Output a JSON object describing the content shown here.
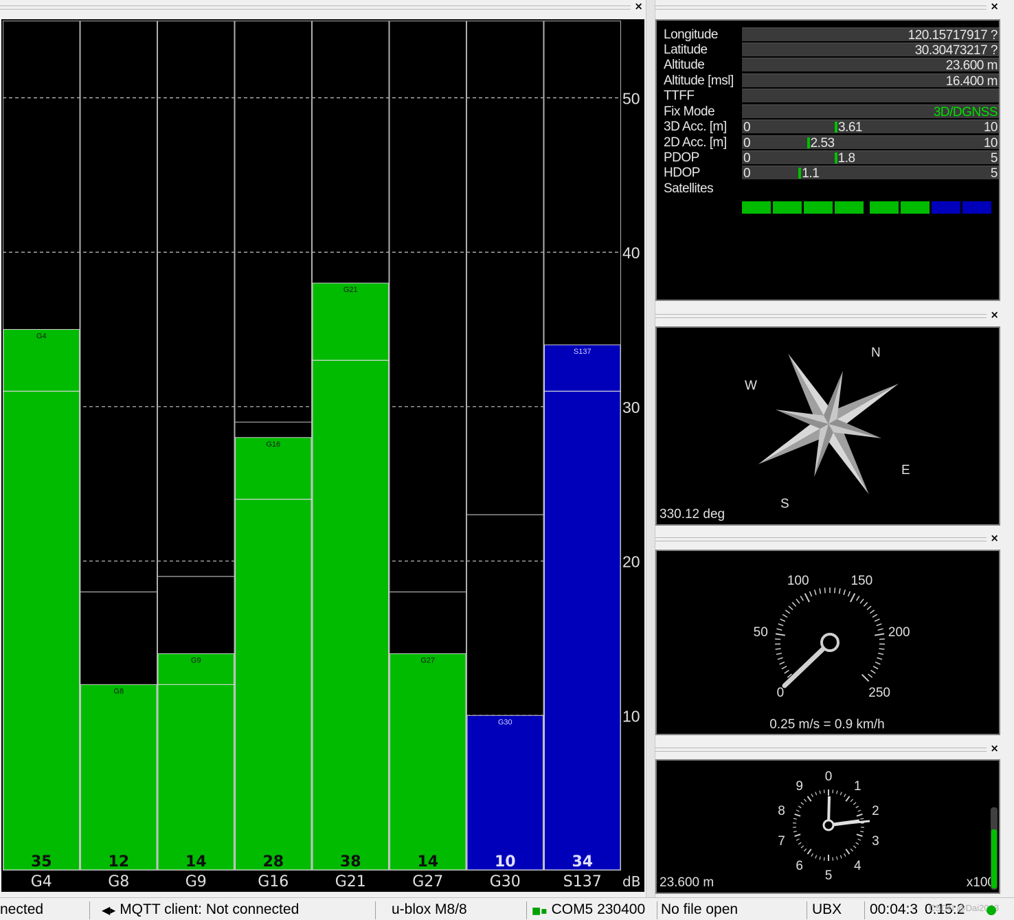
{
  "chart_data": {
    "type": "bar",
    "categories": [
      "G4",
      "G8",
      "G9",
      "G16",
      "G21",
      "G27",
      "G30",
      "S137"
    ],
    "values": [
      35,
      12,
      14,
      28,
      38,
      14,
      10,
      34
    ],
    "secondary_levels": [
      31,
      null,
      12,
      24,
      33,
      null,
      null,
      31
    ],
    "prev_levels": [
      null,
      18,
      19,
      29,
      null,
      18,
      23,
      null
    ],
    "bar_labels": [
      "G4",
      "G8",
      "G9",
      "G16",
      "G21",
      "G27",
      "G30",
      "S137"
    ],
    "bar_colors": [
      "#00bb00",
      "#00bb00",
      "#00bb00",
      "#00bb00",
      "#00bb00",
      "#00bb00",
      "#0000bb",
      "#0000bb"
    ],
    "y_ticks": [
      "10",
      "20",
      "30",
      "40",
      "50"
    ],
    "ylim": [
      0,
      55
    ],
    "unit": "dB",
    "grid": true
  },
  "info": {
    "longitude": {
      "label": "Longitude",
      "value": "120.15717917 ?"
    },
    "latitude": {
      "label": "Latitude",
      "value": "30.30473217 ?"
    },
    "altitude": {
      "label": "Altitude",
      "value": "23.600 m"
    },
    "altitude_msl": {
      "label": "Altitude [msl]",
      "value": "16.400 m"
    },
    "ttff": {
      "label": "TTFF",
      "value": ""
    },
    "fix_mode": {
      "label": "Fix Mode",
      "value": "3D/DGNSS"
    },
    "acc3d": {
      "label": "3D Acc. [m]",
      "min": "0",
      "max": "10",
      "value": "3.61",
      "level": 0.361
    },
    "acc2d": {
      "label": "2D Acc. [m]",
      "min": "0",
      "max": "10",
      "value": "2.53",
      "level": 0.253
    },
    "pdop": {
      "label": "PDOP",
      "min": "0",
      "max": "5",
      "value": "1.8",
      "level": 0.36
    },
    "hdop": {
      "label": "HDOP",
      "min": "0",
      "max": "5",
      "value": "1.1",
      "level": 0.22
    },
    "satellites": {
      "label": "Satellites",
      "colors": [
        "#00bb00",
        "#00bb00",
        "#00bb00",
        "#00bb00",
        "#00bb00",
        "#00bb00",
        "#0000bb",
        "#0000bb"
      ]
    }
  },
  "compass": {
    "n": "N",
    "e": "E",
    "s": "S",
    "w": "W",
    "heading_text": "330.12 deg",
    "heading_deg": 330.12
  },
  "speedo": {
    "ticks": [
      "0",
      "50",
      "100",
      "150",
      "200",
      "250"
    ],
    "readout": "0.25 m/s = 0.9 km/h"
  },
  "altimeter": {
    "ticks": [
      "0",
      "1",
      "2",
      "3",
      "4",
      "5",
      "6",
      "7",
      "8",
      "9"
    ],
    "readout": "23.600 m",
    "scale": "x100"
  },
  "status": {
    "s1": "nected",
    "s2": "MQTT client: Not connected",
    "s3": "u-blox M8/8",
    "s4": "COM5 230400",
    "s5": "No file open",
    "s6": "UBX",
    "s7": "00:04:3",
    "s8": "0:15:2",
    "watermark": "CSDN @Dai2003"
  }
}
